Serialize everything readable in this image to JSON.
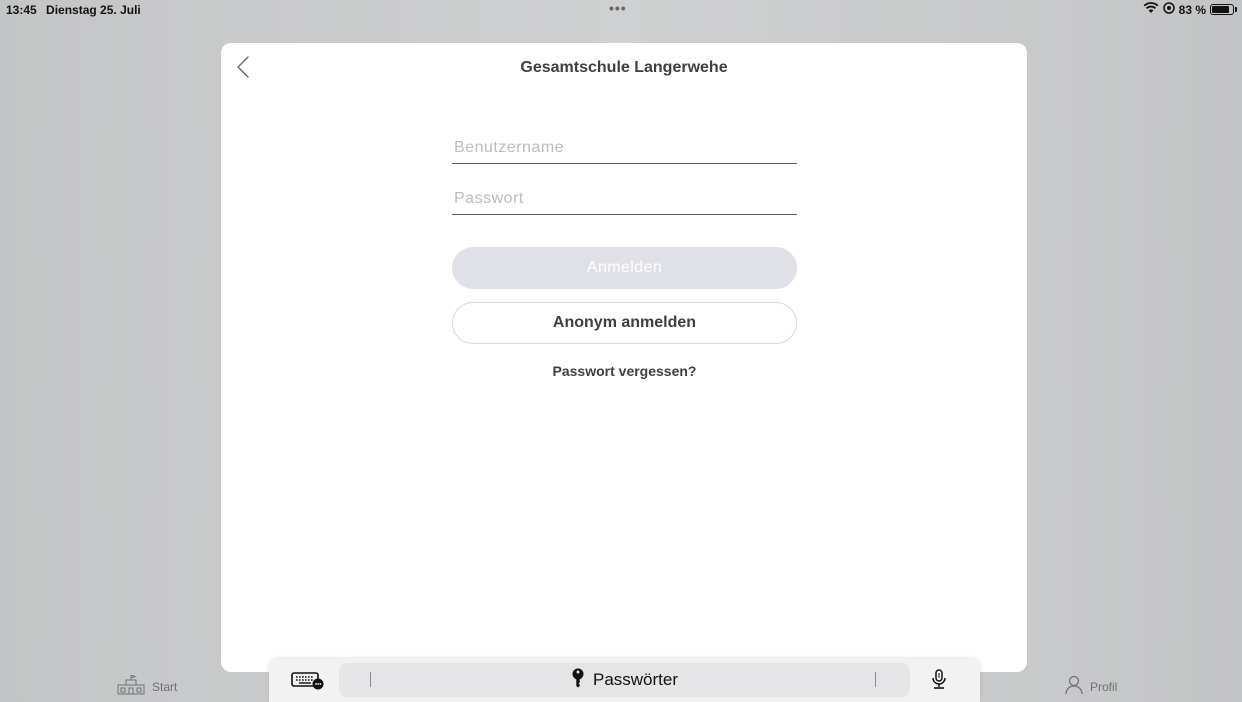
{
  "status_bar": {
    "time": "13:45",
    "date": "Dienstag 25. Juli",
    "dots": "•••",
    "battery": "83 %",
    "battery_level": 0.83
  },
  "modal": {
    "title": "Gesamtschule Langerwehe",
    "username_placeholder": "Benutzername",
    "username_value": "",
    "password_placeholder": "Passwort",
    "password_value": "",
    "login_button": "Anmelden",
    "anonymous_button": "Anonym anmelden",
    "forgot_link": "Passwort vergessen?"
  },
  "tabs": {
    "start": "Start",
    "profile": "Profil"
  },
  "keyboard_bar": {
    "passwords_label": "Passwörter"
  },
  "icons": {
    "wifi": "wifi-icon",
    "location": "location-icon",
    "back": "chevron-left-icon",
    "school": "school-icon",
    "person": "person-icon",
    "keyboard": "keyboard-icon",
    "key": "key-icon",
    "mic": "microphone-icon"
  },
  "colors": {
    "login_button_bg": "#dfe1e7",
    "text_dark": "#3c3f44",
    "placeholder": "#b9bcc2"
  }
}
